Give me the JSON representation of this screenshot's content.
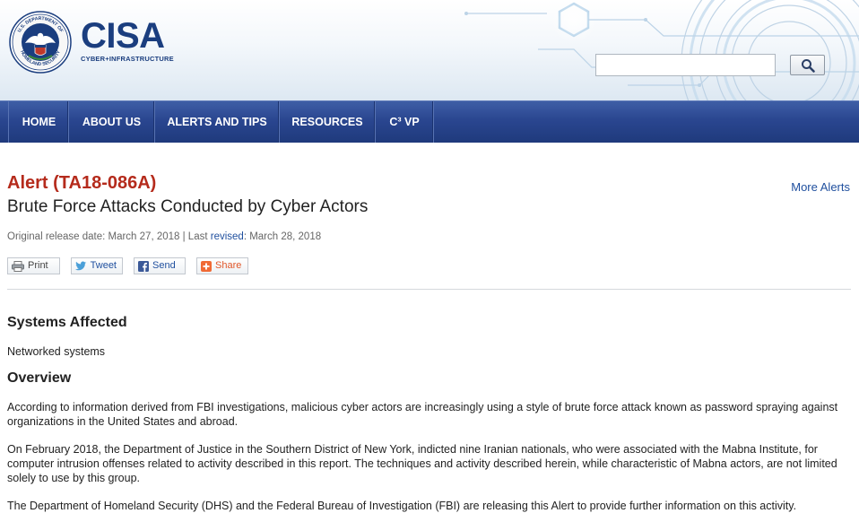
{
  "header": {
    "logo_main": "CISA",
    "logo_sub": "CYBER+INFRASTRUCTURE",
    "seal_label": "U.S. DEPARTMENT OF HOMELAND SECURITY",
    "search_placeholder": "",
    "search_value": "",
    "search_icon": "magnifier-icon"
  },
  "nav": {
    "items": [
      {
        "label": "HOME"
      },
      {
        "label": "ABOUT US"
      },
      {
        "label": "ALERTS AND TIPS"
      },
      {
        "label": "RESOURCES"
      },
      {
        "label": "C³ VP"
      }
    ]
  },
  "alert": {
    "id": "Alert (TA18-086A)",
    "title": "Brute Force Attacks Conducted by Cyber Actors",
    "more_alerts": "More Alerts",
    "release_prefix": "Original release date: March 27, 2018 | Last ",
    "revised_link": "revised",
    "release_suffix": ": March 28, 2018"
  },
  "share": {
    "print": "Print",
    "tweet": "Tweet",
    "send": "Send",
    "share": "Share"
  },
  "body": {
    "systems_heading": "Systems Affected",
    "systems_text": "Networked systems",
    "overview_heading": "Overview",
    "paragraphs": [
      "According to information derived from FBI investigations, malicious cyber actors are increasingly using a style of brute force attack known as password spraying against organizations in the United States and abroad.",
      "On February 2018, the Department of Justice in the Southern District of New York, indicted nine Iranian nationals, who were associated with the Mabna Institute, for computer intrusion offenses related to activity described in this report. The techniques and activity described herein, while characteristic of Mabna actors, are not limited solely to use by this group.",
      "The Department of Homeland Security (DHS) and the Federal Bureau of Investigation (FBI) are releasing this Alert to provide further information on this activity."
    ]
  },
  "colors": {
    "nav_bg": "#2a4690",
    "alert_red": "#b52b1c",
    "link_blue": "#1f4f9e",
    "logo_blue": "#1b3e7f"
  }
}
